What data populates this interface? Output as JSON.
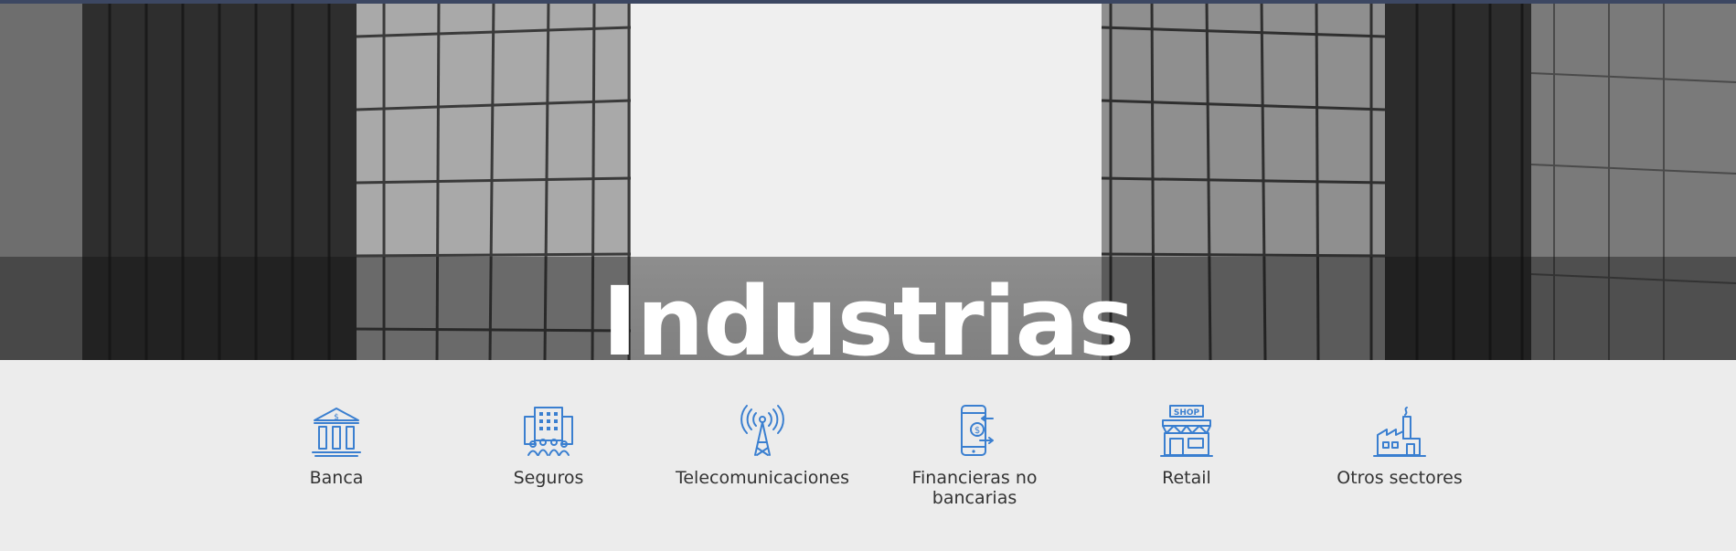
{
  "hero": {
    "title": "Industrias"
  },
  "industries": [
    {
      "label": "Banca",
      "icon": "bank-icon"
    },
    {
      "label": "Seguros",
      "icon": "office-building-people-icon"
    },
    {
      "label": "Telecomunicaciones",
      "icon": "antenna-tower-icon"
    },
    {
      "label": "Financieras no bancarias",
      "icon": "mobile-payment-icon"
    },
    {
      "label": "Retail",
      "icon": "shop-icon",
      "icon_text": "SHOP"
    },
    {
      "label": "Otros sectores",
      "icon": "factory-icon"
    }
  ],
  "colors": {
    "accent": "#3a7fd0",
    "background": "#ececec",
    "text": "#333333",
    "topline": "#3c4762"
  }
}
